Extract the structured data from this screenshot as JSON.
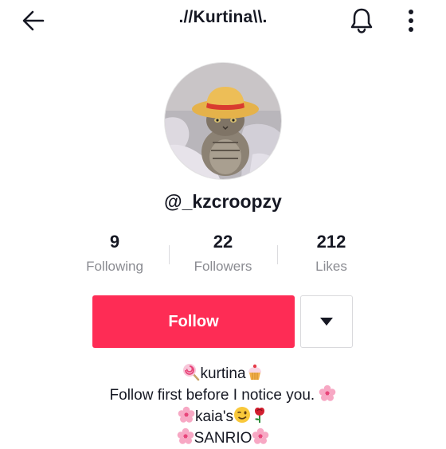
{
  "header": {
    "title": ".//Kurtina\\\\.",
    "back_icon": "arrow-left-icon",
    "notification_icon": "bell-icon",
    "more_icon": "more-vertical-icon"
  },
  "profile": {
    "username": "@_kzcroopzy",
    "avatar_description_icon": "avatar-cat-with-straw-hat"
  },
  "stats": [
    {
      "value": "9",
      "label": "Following"
    },
    {
      "value": "22",
      "label": "Followers"
    },
    {
      "value": "212",
      "label": "Likes"
    }
  ],
  "actions": {
    "follow_label": "Follow",
    "follow_color": "#fe2c55",
    "dropdown_icon": "caret-down-icon"
  },
  "bio": {
    "line1": "kurtina",
    "line2": "Follow first before I notice you.",
    "line3": "kaia's",
    "line4": "SANRIO"
  }
}
